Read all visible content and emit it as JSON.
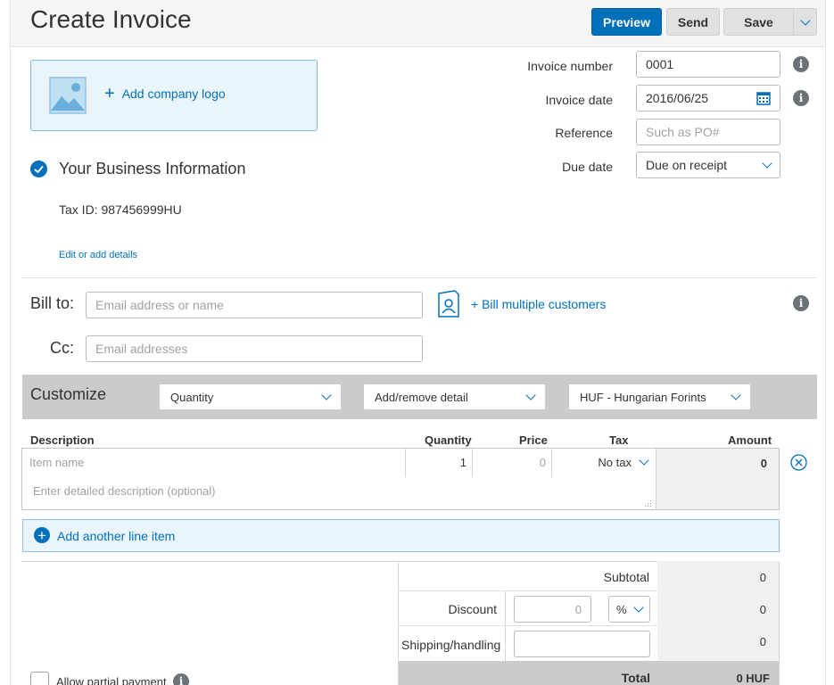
{
  "header": {
    "title": "Create Invoice",
    "preview_label": "Preview",
    "send_label": "Send",
    "save_label": "Save"
  },
  "logo": {
    "add_label": "Add company logo"
  },
  "invoice_fields": {
    "number_label": "Invoice number",
    "number_value": "0001",
    "date_label": "Invoice date",
    "date_value": "2016/06/25",
    "reference_label": "Reference",
    "reference_placeholder": "Such as PO#",
    "due_label": "Due date",
    "due_value": "Due on receipt"
  },
  "business": {
    "title": "Your Business Information",
    "tax_id": "Tax ID: 987456999HU",
    "edit_link": "Edit or add details"
  },
  "billing": {
    "bill_to_label": "Bill to:",
    "bill_to_placeholder": "Email address or name",
    "bill_multiple": "+ Bill multiple customers",
    "cc_label": "Cc:",
    "cc_placeholder": "Email addresses"
  },
  "customize": {
    "title": "Customize",
    "quantity_select": "Quantity",
    "detail_select": "Add/remove detail",
    "currency_select": "HUF - Hungarian Forints"
  },
  "items": {
    "columns": {
      "description": "Description",
      "quantity": "Quantity",
      "price": "Price",
      "tax": "Tax",
      "amount": "Amount"
    },
    "row": {
      "name_placeholder": "Item name",
      "quantity": "1",
      "price_placeholder": "0",
      "tax": "No tax",
      "amount": "0",
      "description_placeholder": "Enter detailed description (optional)"
    },
    "add_line_label": "Add another line item"
  },
  "totals": {
    "subtotal_label": "Subtotal",
    "subtotal_value": "0",
    "discount_label": "Discount",
    "discount_placeholder": "0",
    "discount_unit": "%",
    "discount_value": "0",
    "shipping_label": "Shipping/handling",
    "shipping_value": "0",
    "total_label": "Total",
    "total_value": "0 HUF"
  },
  "options": {
    "partial_payment_label": "Allow partial payment"
  },
  "colors": {
    "primary": "#0070ba",
    "gray_bar": "#cbcbcb",
    "light_blue": "#e9f5fb"
  }
}
